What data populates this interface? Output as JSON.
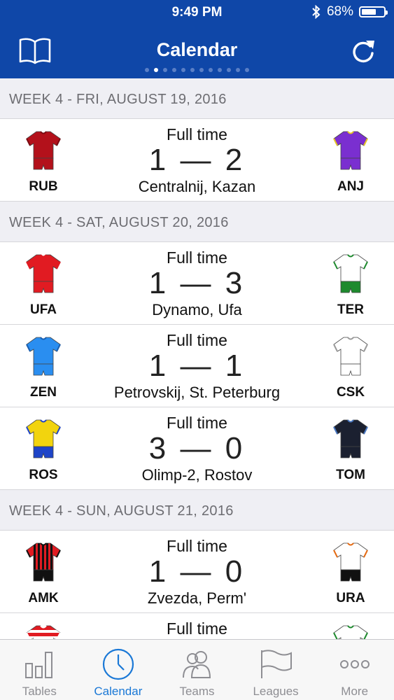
{
  "status_bar": {
    "time": "9:49 PM",
    "battery": "68%",
    "battery_level": 0.68
  },
  "header": {
    "title": "Calendar"
  },
  "pager": {
    "count": 12,
    "active": 1
  },
  "sections": [
    {
      "label": "WEEK 4 - FRI, AUGUST 19, 2016",
      "matches": [
        {
          "status": "Full time",
          "score": "1 — 2",
          "venue": "Centralnij, Kazan",
          "home": {
            "abbr": "RUB",
            "color": "#b3111b",
            "trim": "#7a0b12",
            "pattern": "solid",
            "shorts": "#b3111b"
          },
          "away": {
            "abbr": "ANJ",
            "color": "#7a2fd0",
            "trim": "#e5c624",
            "pattern": "solid",
            "shorts": "#7a2fd0"
          }
        }
      ]
    },
    {
      "label": "WEEK 4 - SAT, AUGUST 20, 2016",
      "matches": [
        {
          "status": "Full time",
          "score": "1 — 3",
          "venue": "Dynamo, Ufa",
          "home": {
            "abbr": "UFA",
            "color": "#e11b22",
            "trim": "#e11b22",
            "pattern": "solid",
            "shorts": "#e11b22"
          },
          "away": {
            "abbr": "TER",
            "color": "#ffffff",
            "trim": "#1e8a2e",
            "pattern": "solid",
            "shorts": "#1e8a2e"
          }
        },
        {
          "status": "Full time",
          "score": "1 — 1",
          "venue": "Petrovskij, St. Peterburg",
          "home": {
            "abbr": "ZEN",
            "color": "#2a8ef0",
            "trim": "#1a5fb0",
            "pattern": "solid",
            "shorts": "#2a8ef0"
          },
          "away": {
            "abbr": "CSK",
            "color": "#ffffff",
            "trim": "#9a9a9a",
            "pattern": "solid",
            "shorts": "#ffffff"
          }
        },
        {
          "status": "Full time",
          "score": "3 — 0",
          "venue": "Olimp-2, Rostov",
          "home": {
            "abbr": "ROS",
            "color": "#f2d40e",
            "trim": "#1e44c8",
            "pattern": "solid",
            "shorts": "#1e44c8"
          },
          "away": {
            "abbr": "TOM",
            "color": "#1b2030",
            "trim": "#4a78c0",
            "pattern": "solid",
            "shorts": "#1b2030"
          }
        }
      ]
    },
    {
      "label": "WEEK 4 - SUN, AUGUST 21, 2016",
      "matches": [
        {
          "status": "Full time",
          "score": "1 — 0",
          "venue": "Zvezda, Perm'",
          "home": {
            "abbr": "AMK",
            "color": "#e11b22",
            "trim": "#111111",
            "pattern": "stripes",
            "shorts": "#111111"
          },
          "away": {
            "abbr": "URA",
            "color": "#ffffff",
            "trim": "#e56a12",
            "pattern": "solid",
            "shorts": "#111111"
          }
        },
        {
          "status": "Full time",
          "score": "",
          "venue": "",
          "partial": true,
          "home": {
            "abbr": "",
            "color": "#e11b22",
            "trim": "#ffffff",
            "pattern": "hoops",
            "shorts": "#e11b22"
          },
          "away": {
            "abbr": "",
            "color": "#ffffff",
            "trim": "#1e8a2e",
            "pattern": "solid",
            "shorts": "#ffffff"
          }
        }
      ]
    }
  ],
  "tabbar": {
    "items": [
      {
        "label": "Tables",
        "icon": "bar-chart-icon",
        "active": false
      },
      {
        "label": "Calendar",
        "icon": "clock-icon",
        "active": true
      },
      {
        "label": "Teams",
        "icon": "people-icon",
        "active": false
      },
      {
        "label": "Leagues",
        "icon": "flag-icon",
        "active": false
      },
      {
        "label": "More",
        "icon": "more-icon",
        "active": false
      }
    ],
    "active_color": "#1a78d6",
    "inactive_color": "#8e8e93"
  },
  "colors": {
    "header": "#0f47a8",
    "section_bg": "#efeff4",
    "section_text": "#6d6d72"
  }
}
